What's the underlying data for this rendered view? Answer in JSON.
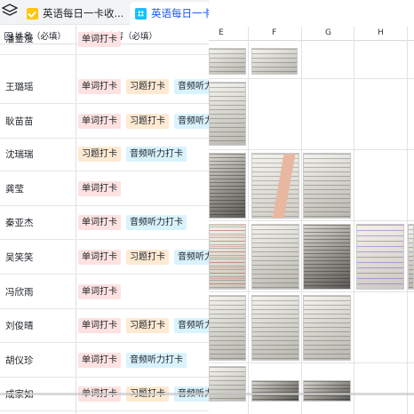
{
  "tabs": [
    {
      "label": "英语每日一卡收...",
      "icon": "checkbox-icon",
      "active": false
    },
    {
      "label": "英语每日一卡",
      "icon": "grid-app-icon",
      "active": true
    }
  ],
  "table": {
    "columns": [
      {
        "label": "姓名（必填）",
        "icon": "text-field-icon"
      },
      {
        "label": "打卡内容（必填）",
        "icon": "multi-select-icon"
      }
    ],
    "rows": [
      {
        "name": "潘金漫",
        "tags": [
          "单词打卡"
        ]
      },
      {
        "name": "王璐瑶",
        "tags": [
          "单词打卡",
          "习题打卡",
          "音频听力打卡"
        ]
      },
      {
        "name": "耿苗苗",
        "tags": [
          "单词打卡",
          "习题打卡",
          "音频听力打卡"
        ]
      },
      {
        "name": "沈瑞瑞",
        "tags": [
          "习题打卡",
          "音频听力打卡"
        ]
      },
      {
        "name": "龚莹",
        "tags": [
          "单词打卡"
        ]
      },
      {
        "name": "秦亚杰",
        "tags": [
          "单词打卡",
          "音频听力打卡"
        ]
      },
      {
        "name": "吴笑笑",
        "tags": [
          "单词打卡",
          "习题打卡",
          "音频听力打卡"
        ]
      },
      {
        "name": "冯欣雨",
        "tags": [
          "单词打卡"
        ]
      },
      {
        "name": "刘俊晴",
        "tags": [
          "单词打卡",
          "习题打卡",
          "音频听力打卡"
        ]
      },
      {
        "name": "胡仪珍",
        "tags": [
          "单词打卡",
          "音频听力打卡"
        ]
      },
      {
        "name": "成家如",
        "tags": [
          "单词打卡",
          "习题打卡",
          "音频听力打卡"
        ]
      }
    ],
    "tag_colors": {
      "单词打卡": "#fde2e1",
      "习题打卡": "#feead2",
      "音频听力打卡": "#d9f3fd"
    }
  },
  "sheet": {
    "column_letters": [
      "E",
      "F",
      "G",
      "H"
    ]
  }
}
